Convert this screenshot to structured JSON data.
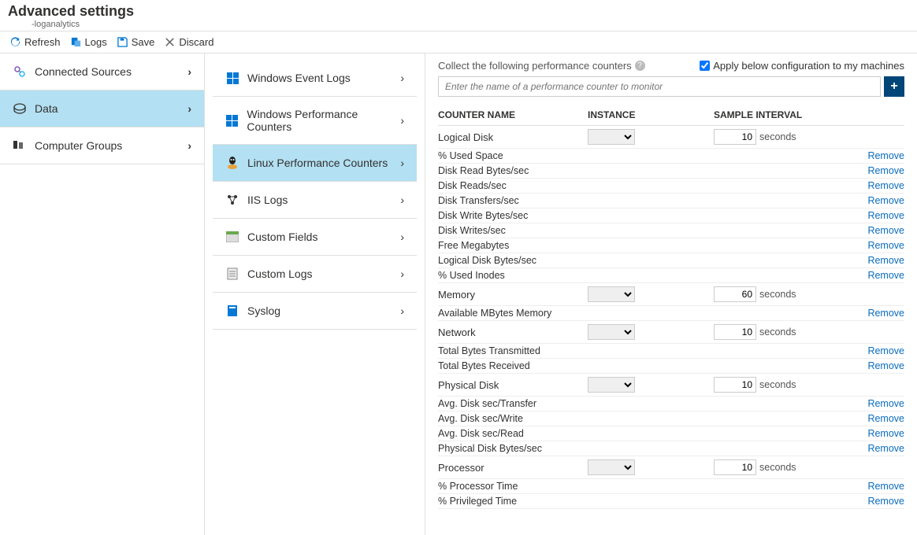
{
  "header": {
    "title": "Advanced settings",
    "subtitle": "-loganalytics"
  },
  "toolbar": {
    "refresh": "Refresh",
    "logs": "Logs",
    "save": "Save",
    "discard": "Discard"
  },
  "nav": {
    "items": [
      {
        "label": "Connected Sources",
        "selected": false,
        "icon": "connected-icon"
      },
      {
        "label": "Data",
        "selected": true,
        "icon": "data-icon"
      },
      {
        "label": "Computer Groups",
        "selected": false,
        "icon": "groups-icon"
      }
    ]
  },
  "subnav": {
    "items": [
      {
        "label": "Windows Event Logs",
        "selected": false
      },
      {
        "label": "Windows Performance Counters",
        "selected": false
      },
      {
        "label": "Linux Performance Counters",
        "selected": true
      },
      {
        "label": "IIS Logs",
        "selected": false
      },
      {
        "label": "Custom Fields",
        "selected": false
      },
      {
        "label": "Custom Logs",
        "selected": false
      },
      {
        "label": "Syslog",
        "selected": false
      }
    ]
  },
  "panel": {
    "description": "Collect the following performance counters",
    "apply_label": "Apply below configuration to my machines",
    "apply_checked": true,
    "search_placeholder": "Enter the name of a performance counter to monitor",
    "columns": {
      "name": "COUNTER NAME",
      "instance": "INSTANCE",
      "interval": "SAMPLE INTERVAL"
    },
    "seconds_label": "seconds",
    "remove_label": "Remove",
    "groups": [
      {
        "name": "Logical Disk",
        "interval": "10",
        "counters": [
          "% Used Space",
          "Disk Read Bytes/sec",
          "Disk Reads/sec",
          "Disk Transfers/sec",
          "Disk Write Bytes/sec",
          "Disk Writes/sec",
          "Free Megabytes",
          "Logical Disk Bytes/sec",
          "% Used Inodes"
        ]
      },
      {
        "name": "Memory",
        "interval": "60",
        "counters": [
          "Available MBytes Memory"
        ]
      },
      {
        "name": "Network",
        "interval": "10",
        "counters": [
          "Total Bytes Transmitted",
          "Total Bytes Received"
        ]
      },
      {
        "name": "Physical Disk",
        "interval": "10",
        "counters": [
          "Avg. Disk sec/Transfer",
          "Avg. Disk sec/Write",
          "Avg. Disk sec/Read",
          "Physical Disk Bytes/sec"
        ]
      },
      {
        "name": "Processor",
        "interval": "10",
        "counters": [
          "% Processor Time",
          "% Privileged Time"
        ]
      }
    ]
  }
}
